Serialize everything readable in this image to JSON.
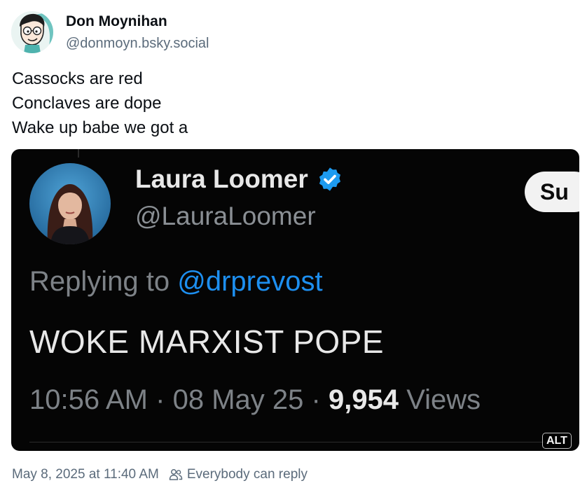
{
  "author": {
    "name": "Don Moynihan",
    "handle": "@donmoyn.bsky.social"
  },
  "post": {
    "lines": [
      "Cassocks are red",
      "Conclaves are dope",
      "Wake up babe we got a"
    ]
  },
  "embed": {
    "quoted": {
      "name": "Laura Loomer",
      "handle": "@LauraLoomer",
      "subscribe_label": "Su",
      "reply_prefix": "Replying to",
      "reply_mention": "@drprevost",
      "text": "WOKE MARXIST POPE",
      "time": "10:56 AM",
      "date": "08 May 25",
      "separator": "·",
      "views_count": "9,954",
      "views_label": "Views"
    },
    "alt_label": "ALT"
  },
  "footer": {
    "timestamp": "May 8, 2025 at 11:40 AM",
    "reply_setting": "Everybody can reply"
  },
  "icons": {
    "verified": "verified-badge-icon",
    "people": "people-icon"
  },
  "colors": {
    "text_primary": "#0b0f14",
    "text_secondary": "#5b6b7b",
    "embed_background": "#050505",
    "mention_blue": "#1d8ff0",
    "verified_blue": "#1d9bf0"
  }
}
